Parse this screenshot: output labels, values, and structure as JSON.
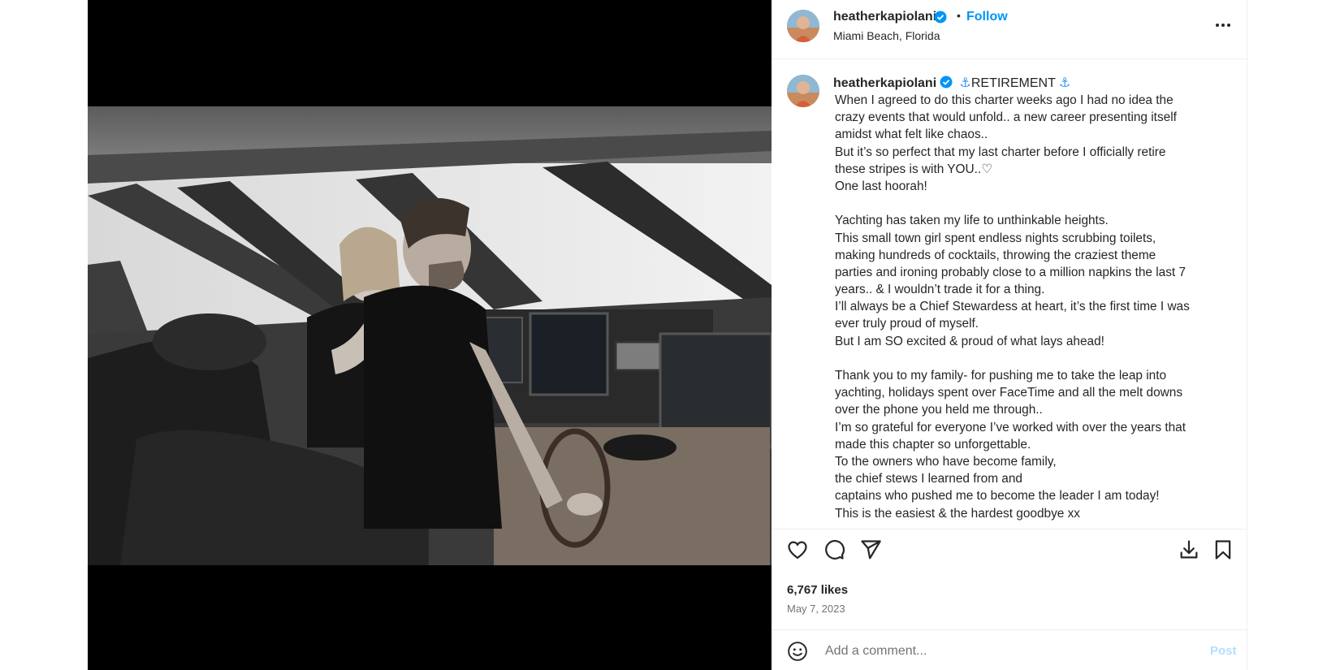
{
  "post": {
    "username": "heatherkapiolani",
    "follow_label": "Follow",
    "separator": "•",
    "location": "Miami Beach, Florida",
    "image_alt": "Black and white photo of a man and woman at the helm of a yacht bridge"
  },
  "caption": {
    "username": "heatherkapiolani",
    "title_anchor_left": "⚓",
    "title": "RETIREMENT",
    "title_anchor_right": "⚓",
    "lines": [
      "When I agreed to do this charter weeks ago I had no idea the",
      "crazy events that would unfold.. a new career presenting itself",
      "amidst what felt like chaos..",
      "But it’s so perfect that my last charter before I officially retire",
      "these stripes is with YOU..♡",
      "One last hoorah!",
      "",
      "Yachting has taken my life to unthinkable heights.",
      "This small town girl spent endless nights scrubbing toilets,",
      "making hundreds of cocktails, throwing the craziest theme",
      "parties and ironing probably close to a million napkins the last 7",
      "years.. & I wouldn’t trade it for a thing.",
      "I’ll always be a Chief Stewardess at heart, it’s the first time I was",
      "ever truly proud of myself.",
      "But I am SO excited & proud of what lays ahead!",
      "",
      "Thank you to my family- for pushing me to take the leap into",
      "yachting, holidays spent over FaceTime and all the melt downs",
      "over the phone you held me through..",
      "I’m so grateful for everyone I’ve worked with over the years that",
      "made this chapter so unforgettable.",
      "To the owners who have become family,",
      "the chief stews I learned from and",
      "captains who pushed me to become the leader I am today!",
      "This is the easiest & the hardest goodbye xx"
    ]
  },
  "stats": {
    "likes": "6,767 likes",
    "date": "May 7, 2023"
  },
  "comment": {
    "placeholder": "Add a comment...",
    "post_label": "Post"
  },
  "icons": {
    "more": "more-options-icon",
    "like": "heart-icon",
    "comment": "comment-icon",
    "share": "paper-plane-icon",
    "download": "download-icon",
    "save": "bookmark-icon",
    "emoji": "emoji-icon",
    "verified": "verified-badge-icon"
  },
  "colors": {
    "accent": "#0095f6",
    "verified": "#0095f6",
    "post_disabled": "#b2dffc",
    "anchor": "#3897f0"
  }
}
